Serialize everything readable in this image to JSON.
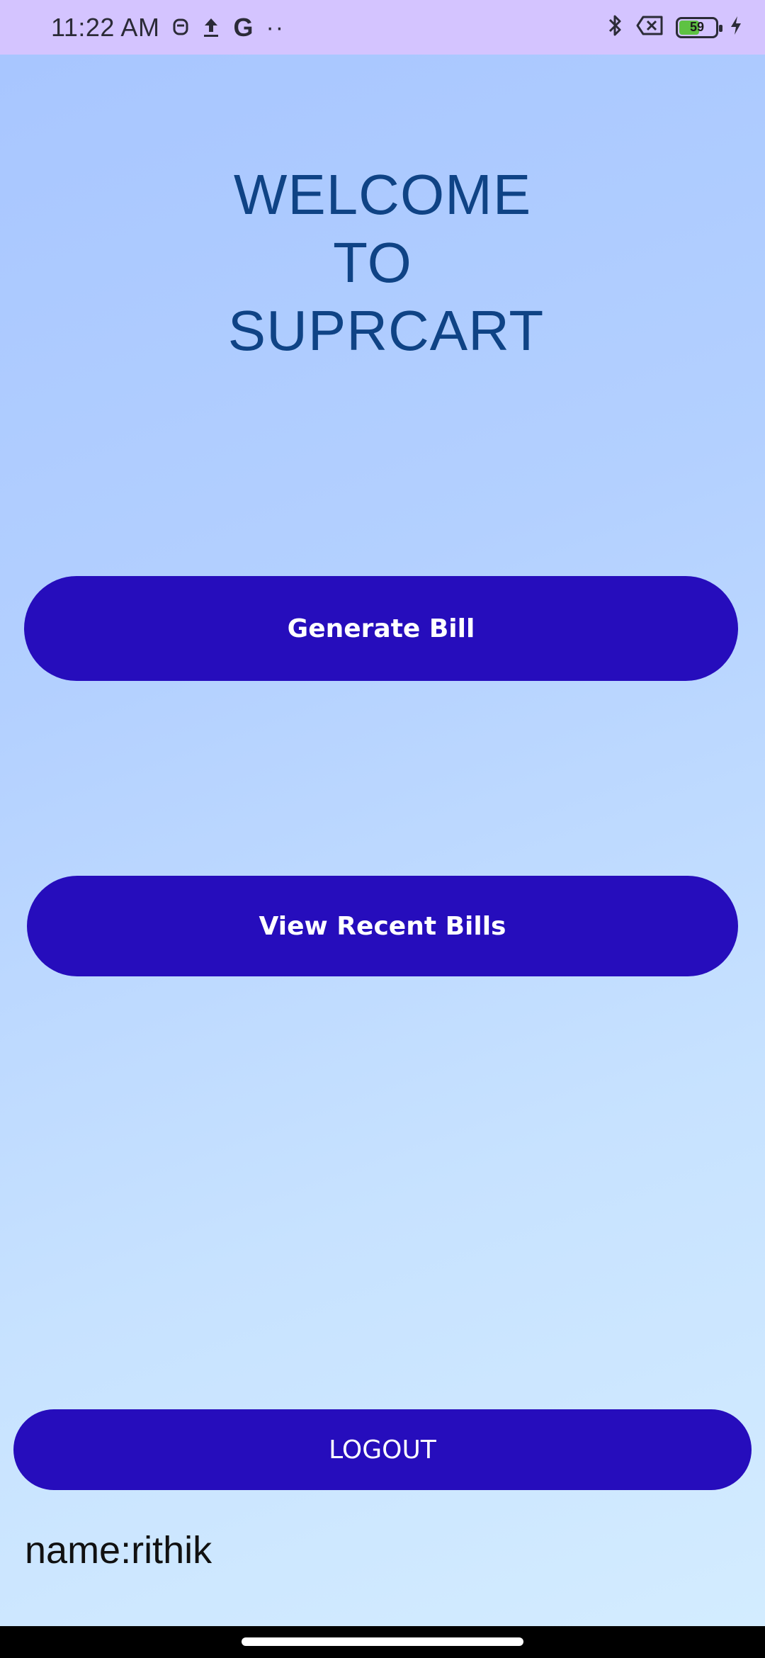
{
  "status_bar": {
    "time": "11:22 AM",
    "left_icons": [
      "notification-icon",
      "upload-icon",
      "google-icon",
      "more-dots-icon"
    ],
    "google_glyph": "G",
    "more_glyph": "··",
    "right_icons": [
      "bluetooth-icon",
      "no-sim-icon",
      "battery-icon",
      "charging-icon"
    ],
    "battery_level": "59",
    "battery_fraction": 0.59
  },
  "welcome": {
    "line1": "WELCOME",
    "line2": "TO",
    "line3": "SUPRCART"
  },
  "buttons": {
    "generate_bill": "Generate Bill",
    "view_recent_bills": "View Recent Bills",
    "logout": "LOGOUT"
  },
  "user": {
    "name_label": "name:rithik"
  },
  "colors": {
    "status_bar_bg": "#d4c4ff",
    "button_bg": "#260dbc",
    "button_text": "#ffffff",
    "title_text": "#0f4385",
    "battery_fill": "#5ec243",
    "nav_bar_bg": "#000000"
  }
}
